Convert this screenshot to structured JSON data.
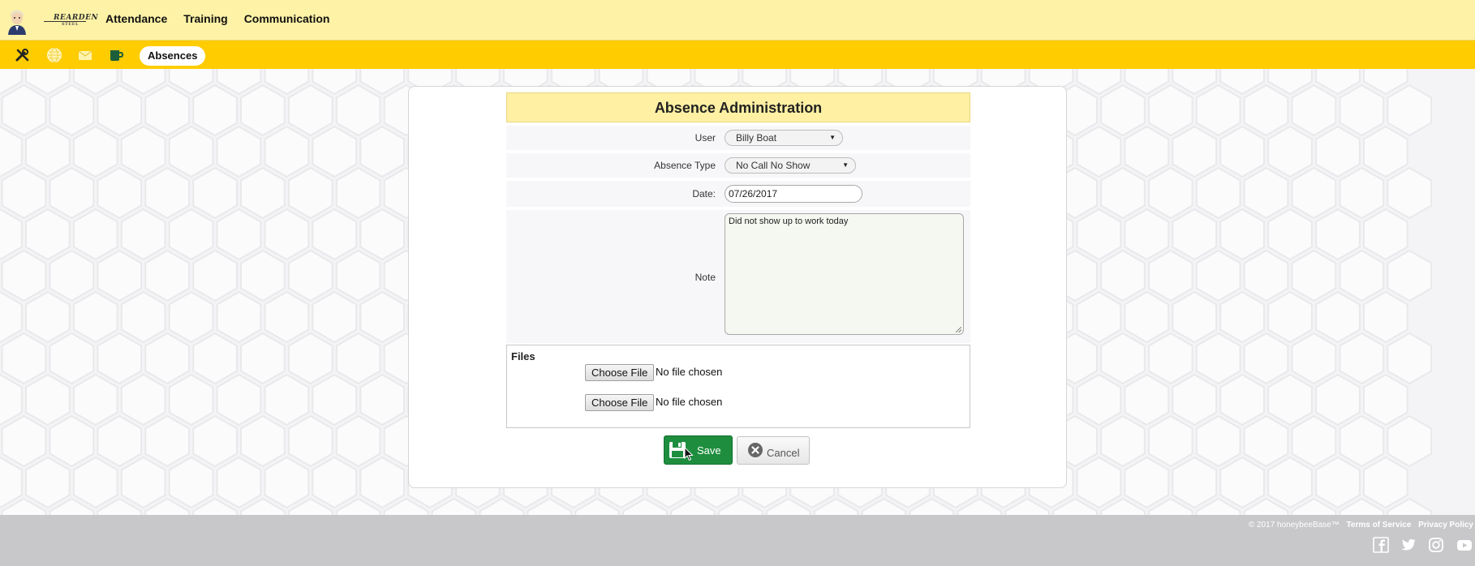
{
  "header": {
    "brand": {
      "name": "REARDEN",
      "sub": "STEEL"
    },
    "nav": [
      {
        "label": "Attendance"
      },
      {
        "label": "Training"
      },
      {
        "label": "Communication"
      }
    ]
  },
  "subnav": {
    "icons": [
      "tools-icon",
      "globe-icon",
      "mail-icon",
      "mug-icon"
    ],
    "active_pill": "Absences"
  },
  "form": {
    "title": "Absence Administration",
    "user": {
      "label": "User",
      "value": "Billy Boat"
    },
    "absence_type": {
      "label": "Absence Type",
      "value": "No Call No Show"
    },
    "date": {
      "label": "Date:",
      "value": "07/26/2017"
    },
    "note": {
      "label": "Note",
      "value": "Did not show up to work today"
    },
    "files": {
      "title": "Files",
      "inputs": [
        {
          "button": "Choose File",
          "status": "No file chosen"
        },
        {
          "button": "Choose File",
          "status": "No file chosen"
        }
      ]
    },
    "save_label": "Save",
    "cancel_label": "Cancel"
  },
  "footer": {
    "copyright": "© 2017 honeybeeBase™",
    "links": [
      "Terms of Service",
      "Privacy Policy"
    ],
    "social": [
      "facebook-icon",
      "twitter-icon",
      "instagram-icon",
      "youtube-icon"
    ]
  },
  "colors": {
    "header_bg": "#fdf2a6",
    "subbar_bg": "#ffcc00",
    "title_bg": "#fff0a3",
    "save_bg": "#1e8e3e",
    "footer_bg": "#c8c7ca"
  }
}
